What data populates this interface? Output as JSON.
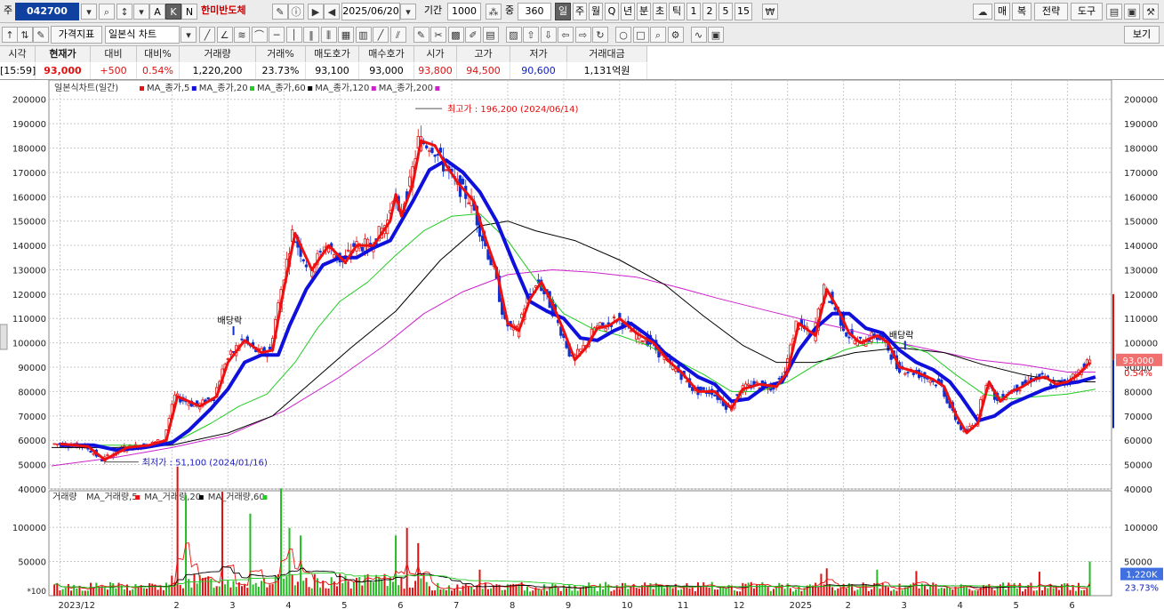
{
  "toolbar": {
    "market_label": "주",
    "code": "042700",
    "name": "한미반도체",
    "date": "2025/06/20",
    "period_label": "기간",
    "period_value": "1000",
    "count_label": "중",
    "count_value": "360",
    "periods": [
      "일",
      "주",
      "월",
      "Q",
      "년",
      "분",
      "초",
      "틱",
      "1",
      "2",
      "5",
      "15"
    ],
    "right_buttons": [
      "매",
      "복",
      "전략",
      "도구"
    ],
    "indicator_label": "가격지표",
    "chart_type": "일본식 차트",
    "view_label": "보기"
  },
  "quote": {
    "headers": [
      "시각",
      "현재가",
      "대비",
      "대비%",
      "거래량",
      "거래%",
      "매도호가",
      "매수호가",
      "시가",
      "고가",
      "저가",
      "거래대금"
    ],
    "values": [
      "[15:59]",
      "93,000",
      "+500",
      "0.54%",
      "1,220,200",
      "23.73%",
      "93,100",
      "93,000",
      "93,800",
      "94,500",
      "90,600",
      "1,131억원"
    ]
  },
  "chart_data": {
    "type": "line",
    "title": "일본식차트(일간)",
    "legend": [
      {
        "name": "MA_종가,5",
        "color": "#ee1010"
      },
      {
        "name": "MA_종가,20",
        "color": "#1010dd"
      },
      {
        "name": "MA_종가,60",
        "color": "#22cc22"
      },
      {
        "name": "MA_종가,120",
        "color": "#000000"
      },
      {
        "name": "MA_종가,200",
        "color": "#cc22cc"
      }
    ],
    "ylim": [
      40000,
      205000
    ],
    "yticks": [
      40000,
      50000,
      60000,
      70000,
      80000,
      90000,
      100000,
      110000,
      120000,
      130000,
      140000,
      150000,
      160000,
      170000,
      180000,
      190000,
      200000
    ],
    "x_months": [
      {
        "label": "2023/12",
        "x": 0
      },
      {
        "label": "2",
        "x": 2
      },
      {
        "label": "3",
        "x": 3
      },
      {
        "label": "4",
        "x": 4
      },
      {
        "label": "5",
        "x": 5
      },
      {
        "label": "6",
        "x": 6
      },
      {
        "label": "7",
        "x": 7
      },
      {
        "label": "8",
        "x": 8
      },
      {
        "label": "9",
        "x": 9
      },
      {
        "label": "10",
        "x": 10
      },
      {
        "label": "11",
        "x": 11
      },
      {
        "label": "12",
        "x": 12
      },
      {
        "label": "2025",
        "x": 13
      },
      {
        "label": "2",
        "x": 14
      },
      {
        "label": "3",
        "x": 15
      },
      {
        "label": "4",
        "x": 16
      },
      {
        "label": "5",
        "x": 17
      },
      {
        "label": "6",
        "x": 18
      }
    ],
    "xlim": [
      -0.15,
      18.55
    ],
    "series": [
      {
        "name": "MA_종가,5",
        "color": "#ee1010",
        "width": 3,
        "points": [
          [
            0,
            58500
          ],
          [
            0.5,
            57500
          ],
          [
            0.8,
            52000
          ],
          [
            1.2,
            57000
          ],
          [
            1.6,
            58000
          ],
          [
            1.9,
            60000
          ],
          [
            2.1,
            78000
          ],
          [
            2.5,
            74000
          ],
          [
            2.8,
            78000
          ],
          [
            3.0,
            92000
          ],
          [
            3.3,
            101000
          ],
          [
            3.6,
            96000
          ],
          [
            3.8,
            97000
          ],
          [
            4.0,
            122000
          ],
          [
            4.2,
            145000
          ],
          [
            4.5,
            130000
          ],
          [
            4.8,
            140000
          ],
          [
            5.1,
            133000
          ],
          [
            5.3,
            140000
          ],
          [
            5.6,
            140000
          ],
          [
            5.9,
            150000
          ],
          [
            6.0,
            161000
          ],
          [
            6.1,
            152000
          ],
          [
            6.3,
            165000
          ],
          [
            6.45,
            183000
          ],
          [
            6.7,
            181000
          ],
          [
            6.9,
            173000
          ],
          [
            7.1,
            166000
          ],
          [
            7.4,
            158000
          ],
          [
            7.6,
            143000
          ],
          [
            7.8,
            130000
          ],
          [
            8.0,
            108000
          ],
          [
            8.2,
            105000
          ],
          [
            8.4,
            118000
          ],
          [
            8.6,
            125000
          ],
          [
            8.8,
            116000
          ],
          [
            9.0,
            105000
          ],
          [
            9.2,
            93000
          ],
          [
            9.4,
            98000
          ],
          [
            9.6,
            106000
          ],
          [
            9.8,
            107000
          ],
          [
            10.0,
            110000
          ],
          [
            10.3,
            104000
          ],
          [
            10.6,
            100000
          ],
          [
            10.9,
            92000
          ],
          [
            11.1,
            88000
          ],
          [
            11.4,
            80000
          ],
          [
            11.7,
            80000
          ],
          [
            12.0,
            73000
          ],
          [
            12.2,
            81000
          ],
          [
            12.5,
            83000
          ],
          [
            12.8,
            82000
          ],
          [
            13.0,
            88000
          ],
          [
            13.2,
            108000
          ],
          [
            13.5,
            103000
          ],
          [
            13.7,
            122000
          ],
          [
            13.9,
            114000
          ],
          [
            14.1,
            104000
          ],
          [
            14.3,
            100000
          ],
          [
            14.6,
            103000
          ],
          [
            14.8,
            100000
          ],
          [
            15.0,
            90000
          ],
          [
            15.3,
            88000
          ],
          [
            15.6,
            85000
          ],
          [
            15.8,
            82000
          ],
          [
            16.0,
            71000
          ],
          [
            16.2,
            63000
          ],
          [
            16.4,
            67000
          ],
          [
            16.6,
            84000
          ],
          [
            16.8,
            76000
          ],
          [
            17.0,
            80000
          ],
          [
            17.2,
            82000
          ],
          [
            17.4,
            85000
          ],
          [
            17.6,
            86000
          ],
          [
            17.8,
            83000
          ],
          [
            18.0,
            84000
          ],
          [
            18.2,
            87000
          ],
          [
            18.4,
            92000
          ]
        ]
      },
      {
        "name": "MA_종가,20",
        "color": "#1010dd",
        "width": 4,
        "points": [
          [
            0,
            58000
          ],
          [
            0.6,
            58000
          ],
          [
            1.0,
            56000
          ],
          [
            1.5,
            57000
          ],
          [
            2.0,
            59000
          ],
          [
            2.3,
            64000
          ],
          [
            2.7,
            73000
          ],
          [
            3.0,
            81000
          ],
          [
            3.3,
            92000
          ],
          [
            3.6,
            95000
          ],
          [
            3.9,
            95000
          ],
          [
            4.1,
            107000
          ],
          [
            4.4,
            122000
          ],
          [
            4.7,
            132000
          ],
          [
            5.0,
            135000
          ],
          [
            5.3,
            135000
          ],
          [
            5.6,
            139000
          ],
          [
            5.9,
            142000
          ],
          [
            6.1,
            150000
          ],
          [
            6.3,
            158000
          ],
          [
            6.6,
            171000
          ],
          [
            6.9,
            175000
          ],
          [
            7.2,
            170000
          ],
          [
            7.5,
            162000
          ],
          [
            7.8,
            150000
          ],
          [
            8.1,
            133000
          ],
          [
            8.4,
            117000
          ],
          [
            8.7,
            113000
          ],
          [
            9.0,
            110000
          ],
          [
            9.3,
            102000
          ],
          [
            9.6,
            101000
          ],
          [
            9.9,
            105000
          ],
          [
            10.2,
            108000
          ],
          [
            10.5,
            103000
          ],
          [
            10.8,
            96000
          ],
          [
            11.1,
            91000
          ],
          [
            11.4,
            86000
          ],
          [
            11.7,
            83000
          ],
          [
            12.0,
            76000
          ],
          [
            12.3,
            77000
          ],
          [
            12.6,
            82000
          ],
          [
            12.9,
            84000
          ],
          [
            13.2,
            97000
          ],
          [
            13.5,
            106000
          ],
          [
            13.8,
            112000
          ],
          [
            14.1,
            112000
          ],
          [
            14.4,
            106000
          ],
          [
            14.7,
            104000
          ],
          [
            15.0,
            97000
          ],
          [
            15.3,
            92000
          ],
          [
            15.6,
            89000
          ],
          [
            15.9,
            84000
          ],
          [
            16.1,
            78000
          ],
          [
            16.4,
            68000
          ],
          [
            16.7,
            70000
          ],
          [
            17.0,
            75000
          ],
          [
            17.3,
            78000
          ],
          [
            17.6,
            81000
          ],
          [
            17.9,
            83000
          ],
          [
            18.2,
            84000
          ],
          [
            18.5,
            86000
          ]
        ]
      },
      {
        "name": "MA_종가,60",
        "color": "#22cc22",
        "width": 1,
        "points": [
          [
            0,
            58000
          ],
          [
            1.0,
            58000
          ],
          [
            1.7,
            58000
          ],
          [
            2.2,
            61000
          ],
          [
            2.7,
            67000
          ],
          [
            3.2,
            74000
          ],
          [
            3.7,
            79000
          ],
          [
            4.2,
            92000
          ],
          [
            4.6,
            106000
          ],
          [
            5.0,
            117000
          ],
          [
            5.5,
            125000
          ],
          [
            6.0,
            136000
          ],
          [
            6.5,
            146000
          ],
          [
            7.0,
            152000
          ],
          [
            7.5,
            153000
          ],
          [
            8.0,
            142000
          ],
          [
            8.5,
            126000
          ],
          [
            9.0,
            112000
          ],
          [
            9.5,
            106000
          ],
          [
            10.0,
            103000
          ],
          [
            10.5,
            99000
          ],
          [
            11.0,
            93000
          ],
          [
            11.5,
            87000
          ],
          [
            12.0,
            80000
          ],
          [
            12.5,
            80000
          ],
          [
            13.0,
            84000
          ],
          [
            13.5,
            91000
          ],
          [
            14.0,
            97000
          ],
          [
            14.5,
            100000
          ],
          [
            15.0,
            100000
          ],
          [
            15.5,
            96000
          ],
          [
            16.0,
            87000
          ],
          [
            16.5,
            79000
          ],
          [
            17.0,
            77000
          ],
          [
            17.5,
            78000
          ],
          [
            18.0,
            79000
          ],
          [
            18.5,
            81000
          ]
        ]
      },
      {
        "name": "MA_종가,120",
        "color": "#000000",
        "width": 1,
        "points": [
          [
            -0.15,
            57000
          ],
          [
            1.0,
            57000
          ],
          [
            2.0,
            58000
          ],
          [
            3.0,
            63000
          ],
          [
            3.8,
            70000
          ],
          [
            4.5,
            84000
          ],
          [
            5.2,
            98000
          ],
          [
            6.0,
            113000
          ],
          [
            6.8,
            134000
          ],
          [
            7.5,
            148000
          ],
          [
            8.0,
            150000
          ],
          [
            8.5,
            146000
          ],
          [
            9.2,
            142000
          ],
          [
            10.0,
            134000
          ],
          [
            10.8,
            124000
          ],
          [
            11.5,
            111000
          ],
          [
            12.2,
            99000
          ],
          [
            12.8,
            92000
          ],
          [
            13.5,
            92000
          ],
          [
            14.2,
            96000
          ],
          [
            15.0,
            98000
          ],
          [
            15.8,
            96000
          ],
          [
            16.5,
            91000
          ],
          [
            17.2,
            87000
          ],
          [
            17.9,
            84000
          ],
          [
            18.5,
            84000
          ]
        ]
      },
      {
        "name": "MA_종가,200",
        "color": "#cc22cc",
        "width": 1,
        "points": [
          [
            -0.15,
            49500
          ],
          [
            1.0,
            53000
          ],
          [
            2.0,
            57000
          ],
          [
            3.0,
            62000
          ],
          [
            4.0,
            72000
          ],
          [
            5.0,
            86000
          ],
          [
            5.8,
            99000
          ],
          [
            6.5,
            112000
          ],
          [
            7.2,
            121000
          ],
          [
            8.0,
            128000
          ],
          [
            8.8,
            130000
          ],
          [
            9.5,
            129000
          ],
          [
            10.3,
            127000
          ],
          [
            11.0,
            123000
          ],
          [
            11.8,
            118000
          ],
          [
            12.5,
            114000
          ],
          [
            13.2,
            110000
          ],
          [
            14.0,
            106000
          ],
          [
            14.8,
            101000
          ],
          [
            15.6,
            97000
          ],
          [
            16.4,
            93000
          ],
          [
            17.2,
            91000
          ],
          [
            18.0,
            88000
          ],
          [
            18.5,
            88000
          ]
        ]
      }
    ],
    "annotations": [
      {
        "text": "최고가 : 196,200 (2024/06/14)",
        "x": 6.35,
        "y": 196200,
        "color": "#e01010"
      },
      {
        "text": "최저가 : 51,100 (2024/01/16)",
        "x": 0.8,
        "y": 51100,
        "color": "#2020c0"
      },
      {
        "text": "배당락",
        "x": 3.1,
        "y": 105000,
        "color": "#000000"
      },
      {
        "text": "배당락",
        "x": 15.1,
        "y": 99000,
        "color": "#000000"
      }
    ],
    "price_tag": {
      "value": "93,000",
      "pct": "0.54%",
      "y": 93000
    },
    "volume": {
      "title": "거래량",
      "legend": [
        {
          "name": "MA_거래량,5",
          "color": "#ee1010"
        },
        {
          "name": "MA_거래량,20",
          "color": "#000000"
        },
        {
          "name": "MA_거래량,60",
          "color": "#22cc22"
        }
      ],
      "ylim": [
        0,
        130000
      ],
      "yticks": [
        50000,
        100000
      ],
      "unit_label": "*100",
      "tag_value": "1,220K",
      "tag_pct": "23.73%"
    }
  }
}
